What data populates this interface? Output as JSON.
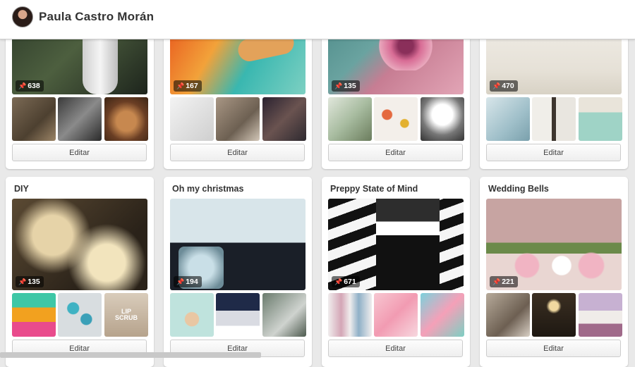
{
  "header": {
    "username": "Paula Castro Morán"
  },
  "boards": [
    {
      "title": "",
      "pin_count": "638",
      "edit_label": "Editar",
      "cover_icon": "owl-tail-photo",
      "thumb_icons": [
        "owls-photo",
        "giraffes-photo",
        "owl-photo"
      ],
      "colors": {
        "cover": "#3b4a35",
        "t1": "#6b5a45",
        "t2": "#555555",
        "t3": "#8a5a3a"
      }
    },
    {
      "title": "",
      "pin_count": "167",
      "edit_label": "Editar",
      "cover_icon": "flowers-sandals-photo",
      "thumb_icons": [
        "white-door-photo",
        "table-photo",
        "dolls-photo"
      ],
      "colors": {
        "cover": "#e07b2a",
        "t1": "#dcdcdc",
        "t2": "#9a8a7a",
        "t3": "#3a3040"
      }
    },
    {
      "title": "",
      "pin_count": "135",
      "edit_label": "Editar",
      "cover_icon": "orchid-photo",
      "thumb_icons": [
        "bouquet-photo",
        "flowers-photo",
        "white-flowers-photo"
      ],
      "colors": {
        "cover": "#c9778a",
        "t1": "#d8e0d0",
        "t2": "#e8e4e0",
        "t3": "#555555"
      }
    },
    {
      "title": "",
      "pin_count": "470",
      "edit_label": "Editar",
      "cover_icon": "white-room-photo",
      "thumb_icons": [
        "window-room-photo",
        "barn-door-photo",
        "piano-photo"
      ],
      "colors": {
        "cover": "#ece9e2",
        "t1": "#bfd2d9",
        "t2": "#d9d6d0",
        "t3": "#a8d2c9"
      }
    },
    {
      "title": "DIY",
      "pin_count": "135",
      "edit_label": "Editar",
      "cover_icon": "glitter-jars-photo",
      "thumb_icons": [
        "colored-blocks-photo",
        "painted-eggs-photo",
        "lip-scrub-photo"
      ],
      "thumb_text": {
        "t3": "LIP SCRUB"
      },
      "colors": {
        "cover": "#8a7350",
        "t1": "#f0f0f0",
        "t2": "#b9c0c6",
        "t3": "#cdbfae"
      }
    },
    {
      "title": "Oh my christmas",
      "pin_count": "194",
      "edit_label": "Editar",
      "cover_icon": "snow-globes-photo",
      "thumb_icons": [
        "reindeer-photo",
        "christmas-house-photo",
        "porch-photo"
      ],
      "colors": {
        "cover": "#a9c0ca",
        "t1": "#bfe0dc",
        "t2": "#2c3a55",
        "t3": "#6b7f70"
      }
    },
    {
      "title": "Preppy State of Mind",
      "pin_count": "671",
      "edit_label": "Editar",
      "cover_icon": "striped-stairs-outfit-photo",
      "thumb_icons": [
        "outfits-photo",
        "pink-dress-photo",
        "floral-dress-photo"
      ],
      "colors": {
        "cover": "#222222",
        "t1": "#f0eeee",
        "t2": "#f5b9c6",
        "t3": "#6ec5d3"
      }
    },
    {
      "title": "Wedding Bells",
      "pin_count": "221",
      "edit_label": "Editar",
      "cover_icon": "wedding-flowers-photo",
      "thumb_icons": [
        "wedding-tent-photo",
        "wedding-lights-photo",
        "wedding-arch-photo"
      ],
      "colors": {
        "cover": "#b58e8c",
        "t1": "#9a8a7a",
        "t2": "#4a3a2a",
        "t3": "#c8b0c8"
      }
    }
  ]
}
